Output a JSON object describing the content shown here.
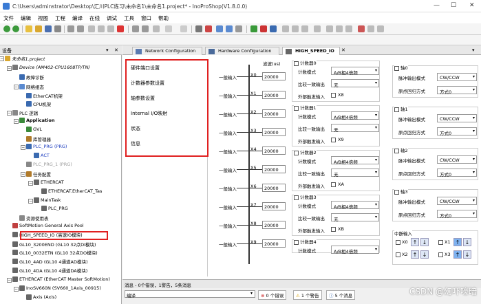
{
  "window": {
    "title": "C:\\Users\\adminstrator\\Desktop\\汇川PLC练习\\未命名1\\未命名1.project* - InoProShop(V1.8.0.0)"
  },
  "menu": [
    "文件",
    "编辑",
    "视图",
    "工程",
    "编译",
    "在线",
    "调试",
    "工具",
    "窗口",
    "帮助"
  ],
  "device_panel": {
    "title": "设备",
    "tree": [
      "未命名1.project",
      "Device (AM402-CPU1608TP/TN)",
      "故障诊断",
      "网络组态",
      "EtherCAT机架",
      "CPU机架",
      "PLC 逻辑",
      "Application",
      "GVL",
      "库管理器",
      "PLC_PRG (PRG)",
      "ACT",
      "PLC_PRG_1 (PRG)",
      "任务配置",
      "ETHERCAT",
      "ETHERCAT.EtherCAT_Tas",
      "MainTask",
      "PLC_PRG",
      "资源使用表",
      "SoftMotion General Axis Pool",
      "HIGH_SPEED_IO (高速IO模块)",
      "GL10_3200END (GL10 32点DI模块)",
      "GL10_0032ETN (GL10 32点DO模块)",
      "GL10_4AD (GL10 4通道AD模块)",
      "GL10_4DA (GL10 4通道DA模块)",
      "ETHERCAT (EtherCAT Master SoftMotion)",
      "InoSV660N (SV660_1Axis_00915)",
      "Axis (Axis)"
    ]
  },
  "tabs": [
    "Network Configuration",
    "Hardware Configuration",
    "HIGH_SPEED_IO"
  ],
  "nav": [
    "硬件端口设置",
    "计数器参数设置",
    "轴参数设置",
    "Internal I/O映射",
    "状态",
    "信息"
  ],
  "inputs": {
    "filter_header": "滤波(us)",
    "rows": [
      {
        "label": "一般输入",
        "port": "X0",
        "value": "20000"
      },
      {
        "label": "一般输入",
        "port": "X1",
        "value": "20000"
      },
      {
        "label": "一般输入",
        "port": "X2",
        "value": "20000"
      },
      {
        "label": "一般输入",
        "port": "X3",
        "value": "20000"
      },
      {
        "label": "一般输入",
        "port": "X4",
        "value": "20000"
      },
      {
        "label": "一般输入",
        "port": "X5",
        "value": "20000"
      },
      {
        "label": "一般输入",
        "port": "X6",
        "value": "20000"
      },
      {
        "label": "一般输入",
        "port": "X7",
        "value": "20000"
      },
      {
        "label": "一般输入",
        "port": "X8",
        "value": "20000"
      },
      {
        "label": "一般输入",
        "port": "X9",
        "value": "20000"
      }
    ]
  },
  "counters": [
    {
      "name": "计数器0",
      "mode_label": "计数模式",
      "mode": "A/B相4倍频",
      "cmp_label": "比较一致输出",
      "cmp": "无",
      "ext_label": "外部触发输入",
      "ext": "X8"
    },
    {
      "name": "计数器1",
      "mode_label": "计数模式",
      "mode": "A/B相4倍频",
      "cmp_label": "比较一致输出",
      "cmp": "无",
      "ext_label": "外部触发输入",
      "ext": "X9"
    },
    {
      "name": "计数器2",
      "mode_label": "计数模式",
      "mode": "A/B相4倍频",
      "cmp_label": "比较一致输出",
      "cmp": "无",
      "ext_label": "外部触发输入",
      "ext": "XA"
    },
    {
      "name": "计数器3",
      "mode_label": "计数模式",
      "mode": "A/B相4倍频",
      "cmp_label": "比较一致输出",
      "cmp": "无",
      "ext_label": "外部触发输入",
      "ext": "XB"
    },
    {
      "name": "计数器4",
      "mode_label": "计数模式",
      "mode": "A/B相4倍频"
    }
  ],
  "axes": [
    {
      "name": "轴0",
      "pulse_label": "脉冲输出模式",
      "pulse": "CW/CCW",
      "home_label": "原点回归方式",
      "home": "方式0"
    },
    {
      "name": "轴1",
      "pulse_label": "脉冲输出模式",
      "pulse": "CW/CCW",
      "home_label": "原点回归方式",
      "home": "方式0"
    },
    {
      "name": "轴2",
      "pulse_label": "脉冲输出模式",
      "pulse": "CW/CCW",
      "home_label": "原点回归方式",
      "home": "方式0"
    },
    {
      "name": "轴3",
      "pulse_label": "脉冲输出模式",
      "pulse": "CW/CCW",
      "home_label": "原点回归方式",
      "home": "方式0"
    }
  ],
  "interrupts": {
    "title": "中断输入",
    "items": [
      "X0",
      "X1",
      "X2",
      "X3"
    ]
  },
  "messages": {
    "title": "消息 - 0个错误，1警告，5条消息",
    "source": "编译",
    "errors": "0 个错误",
    "warnings": "1 个警告",
    "msgs": "5 个消息"
  },
  "watermark": "CSDN @幻吓嚎暗"
}
